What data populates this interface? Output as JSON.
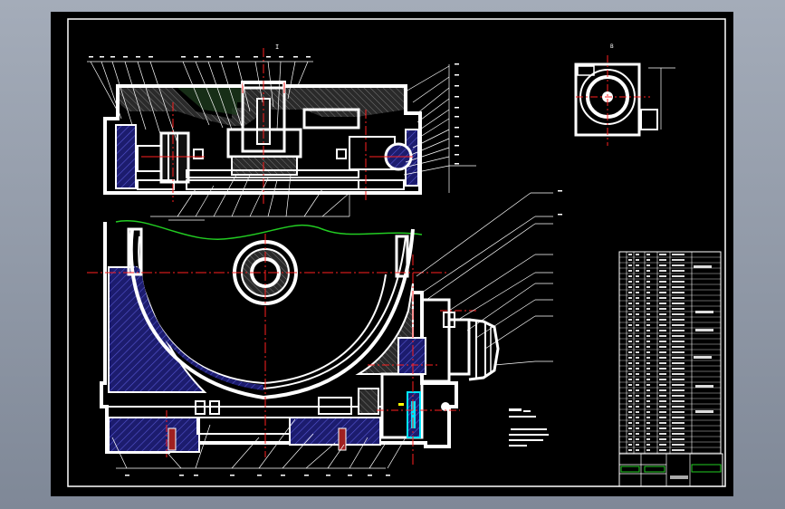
{
  "drawing": {
    "top_view_label": "I",
    "aux_view_label": "B",
    "section_note": "",
    "note_block": "",
    "tech_notes": ""
  },
  "colors": {
    "background": "#000000",
    "outline": "#ffffff",
    "hatch": "#2a2a9a",
    "section_fill": "#3a3a3a",
    "center_line": "#ff2020",
    "break_line": "#22cc22",
    "highlight": "#ffff00",
    "accent": "#00e5ff"
  },
  "balloons_top": [
    "",
    "",
    "",
    "",
    "",
    "",
    "",
    "",
    "",
    "",
    "",
    "",
    "",
    "",
    "",
    ""
  ],
  "balloons_right": [
    "",
    "",
    "",
    "",
    "",
    "",
    "",
    "",
    "",
    "",
    "",
    "",
    ""
  ],
  "balloons_bottom": [
    "",
    "",
    "",
    "",
    "",
    "",
    "",
    "",
    "",
    "",
    ""
  ]
}
